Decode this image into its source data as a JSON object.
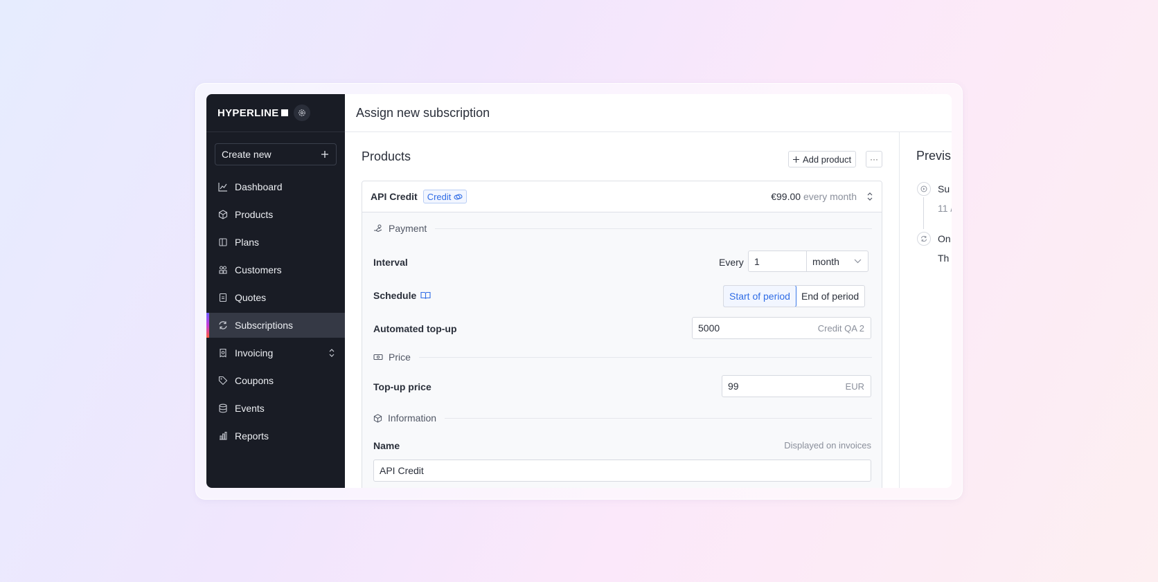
{
  "brand": {
    "logo_text": "HYPERLINE"
  },
  "sidebar": {
    "create_label": "Create new",
    "items": [
      {
        "label": "Dashboard",
        "icon": "chart-line-icon"
      },
      {
        "label": "Products",
        "icon": "cube-icon"
      },
      {
        "label": "Plans",
        "icon": "columns-icon"
      },
      {
        "label": "Customers",
        "icon": "users-icon"
      },
      {
        "label": "Quotes",
        "icon": "document-icon"
      },
      {
        "label": "Subscriptions",
        "icon": "refresh-icon",
        "active": true
      },
      {
        "label": "Invoicing",
        "icon": "receipt-icon",
        "expandable": true
      },
      {
        "label": "Coupons",
        "icon": "tag-icon"
      },
      {
        "label": "Events",
        "icon": "database-icon"
      },
      {
        "label": "Reports",
        "icon": "bar-chart-icon"
      }
    ]
  },
  "header": {
    "title": "Assign new subscription"
  },
  "products": {
    "title": "Products",
    "add_label": "Add product",
    "more_label": "···",
    "item": {
      "name": "API Credit",
      "badge": "Credit",
      "price": "€99.00",
      "period": "every month"
    },
    "payment": {
      "section_label": "Payment",
      "interval_label": "Interval",
      "every_label": "Every",
      "interval_count": "1",
      "interval_unit": "month",
      "schedule_label": "Schedule",
      "schedule_options": [
        "Start of period",
        "End of period"
      ],
      "schedule_selected": "Start of period",
      "topup_label": "Automated top-up",
      "topup_value": "5000",
      "topup_suffix": "Credit QA 2"
    },
    "price": {
      "section_label": "Price",
      "topup_price_label": "Top-up price",
      "topup_price_value": "99",
      "currency": "EUR"
    },
    "information": {
      "section_label": "Information",
      "name_label": "Name",
      "name_hint": "Displayed on invoices",
      "name_value": "API Credit"
    }
  },
  "preview": {
    "title": "Previs",
    "events": [
      {
        "title": "Su",
        "sub": "11 /"
      },
      {
        "title": "On",
        "sub": "Th"
      }
    ]
  },
  "colors": {
    "sidebar_bg": "#191c25",
    "accent": "#2f6ce5",
    "active_item_bg": "#353945"
  }
}
